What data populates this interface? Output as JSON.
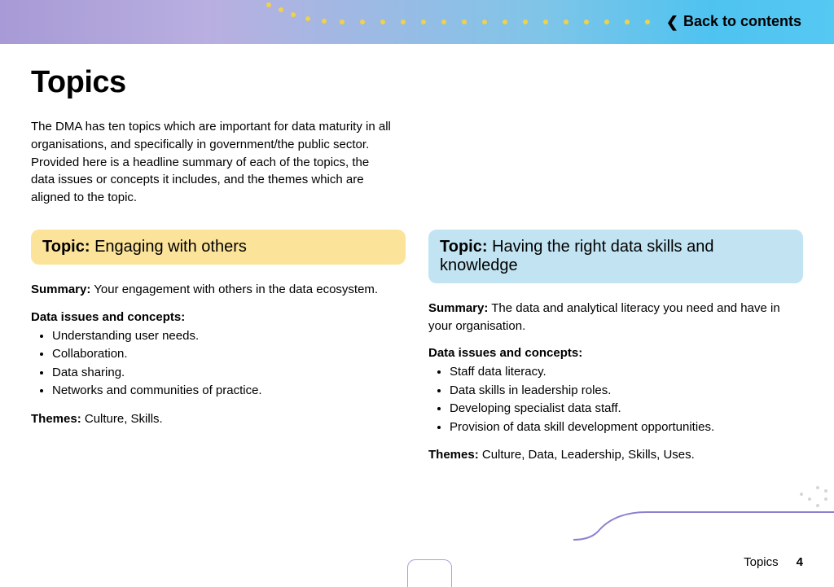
{
  "header": {
    "back_label": "Back to contents"
  },
  "page": {
    "title": "Topics",
    "intro": "The DMA has ten topics which are important for data maturity in all organisations, and specifically in government/the public sector. Provided here is a headline summary of each of the topics, the data issues or concepts it includes, and the themes which are aligned to the topic."
  },
  "labels": {
    "topic_prefix": "Topic:",
    "summary_prefix": "Summary:",
    "concepts_heading": "Data issues and concepts:",
    "themes_prefix": "Themes:"
  },
  "topics": [
    {
      "color": "yellow",
      "title": "Engaging with others",
      "summary": "Your engagement with others in the data ecosystem.",
      "concepts": [
        "Understanding user needs.",
        "Collaboration.",
        "Data sharing.",
        "Networks and communities of practice."
      ],
      "themes": "Culture, Skills."
    },
    {
      "color": "blue",
      "title": "Having the right data skills and knowledge",
      "summary": "The data and analytical literacy you need and have in your organisation.",
      "concepts": [
        "Staff data literacy.",
        "Data skills in leadership roles.",
        "Developing specialist data staff.",
        "Provision of data skill development opportunities."
      ],
      "themes": "Culture, Data, Leadership, Skills, Uses."
    }
  ],
  "footer": {
    "section": "Topics",
    "page_number": "4"
  }
}
